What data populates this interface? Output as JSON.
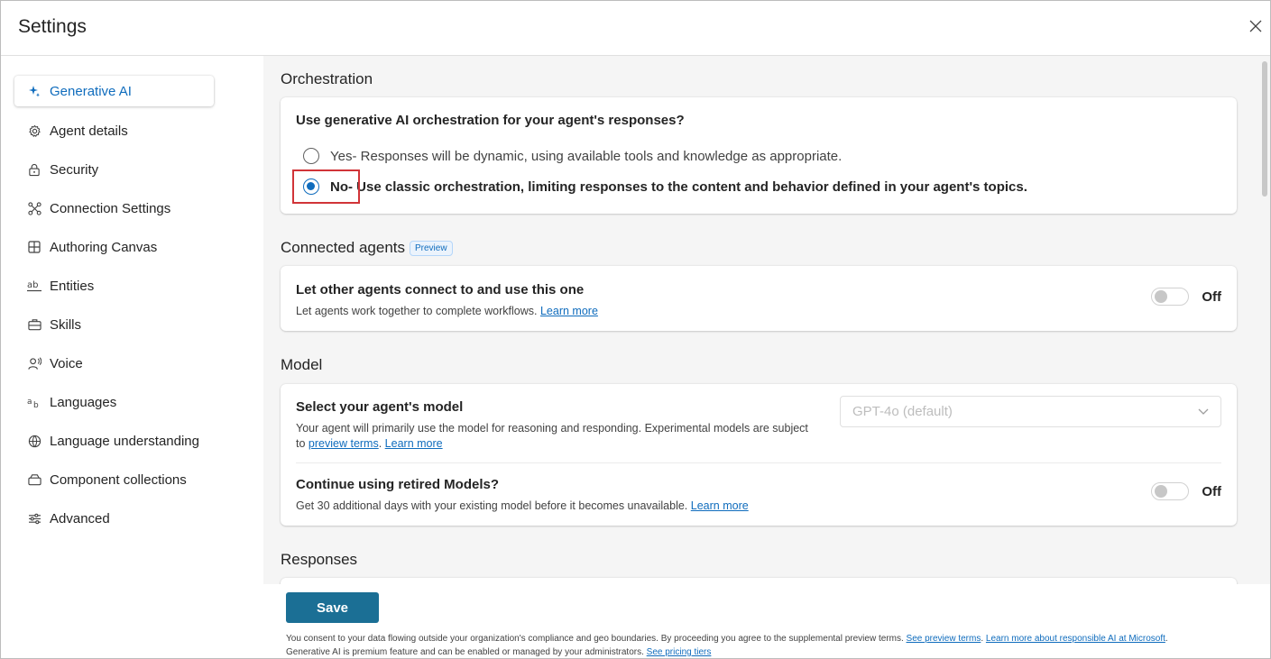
{
  "header": {
    "title": "Settings"
  },
  "sidebar": {
    "items": [
      {
        "label": "Generative AI",
        "icon": "sparkle-icon"
      },
      {
        "label": "Agent details",
        "icon": "gear-icon"
      },
      {
        "label": "Security",
        "icon": "lock-icon"
      },
      {
        "label": "Connection Settings",
        "icon": "connection-icon"
      },
      {
        "label": "Authoring Canvas",
        "icon": "grid-icon"
      },
      {
        "label": "Entities",
        "icon": "entity-icon"
      },
      {
        "label": "Skills",
        "icon": "briefcase-icon"
      },
      {
        "label": "Voice",
        "icon": "voice-icon"
      },
      {
        "label": "Languages",
        "icon": "translate-icon"
      },
      {
        "label": "Language understanding",
        "icon": "globe-icon"
      },
      {
        "label": "Component collections",
        "icon": "collection-icon"
      },
      {
        "label": "Advanced",
        "icon": "sliders-icon"
      }
    ],
    "active_index": 0
  },
  "orchestration": {
    "title": "Orchestration",
    "question": "Use generative AI orchestration for your agent's responses?",
    "options": [
      {
        "lead": "Yes",
        "text": " - Responses will be dynamic, using available tools and knowledge as appropriate.",
        "checked": false
      },
      {
        "lead": "No",
        "text": " - Use classic orchestration, limiting responses to the content and behavior defined in your agent's topics.",
        "checked": true
      }
    ]
  },
  "connected_agents": {
    "title": "Connected agents",
    "badge": "Preview",
    "row_title": "Let other agents connect to and use this one",
    "row_desc": "Let agents work together to complete workflows.",
    "link": "Learn more",
    "toggle_label": "Off"
  },
  "model": {
    "title": "Model",
    "select_title": "Select your agent's model",
    "select_desc_1": "Your agent will primarily use the model for reasoning and responding. Experimental models are subject",
    "select_desc_2": "to",
    "preview_terms_link": "preview terms",
    "learn_more_link": "Learn more",
    "dropdown_value": "GPT-4o (default)",
    "retired_title": "Continue using retired Models?",
    "retired_desc": "Get 30 additional days with your existing model before it becomes unavailable.",
    "retired_link": "Learn more",
    "toggle_label": "Off"
  },
  "responses": {
    "title": "Responses"
  },
  "footer": {
    "save_label": "Save",
    "consent_text": "You consent to your data flowing outside your organization's compliance and geo boundaries. By proceeding you agree to the supplemental preview terms.",
    "see_preview_terms": "See preview terms",
    "learn_more_ai": "Learn more about responsible AI at Microsoft",
    "premium_text": "Generative AI is premium feature and can be enabled or managed by your administrators.",
    "see_pricing": "See pricing tiers"
  },
  "colors": {
    "accent": "#0f6cbd",
    "save_button": "#1b6f95",
    "highlight": "#d13438"
  }
}
